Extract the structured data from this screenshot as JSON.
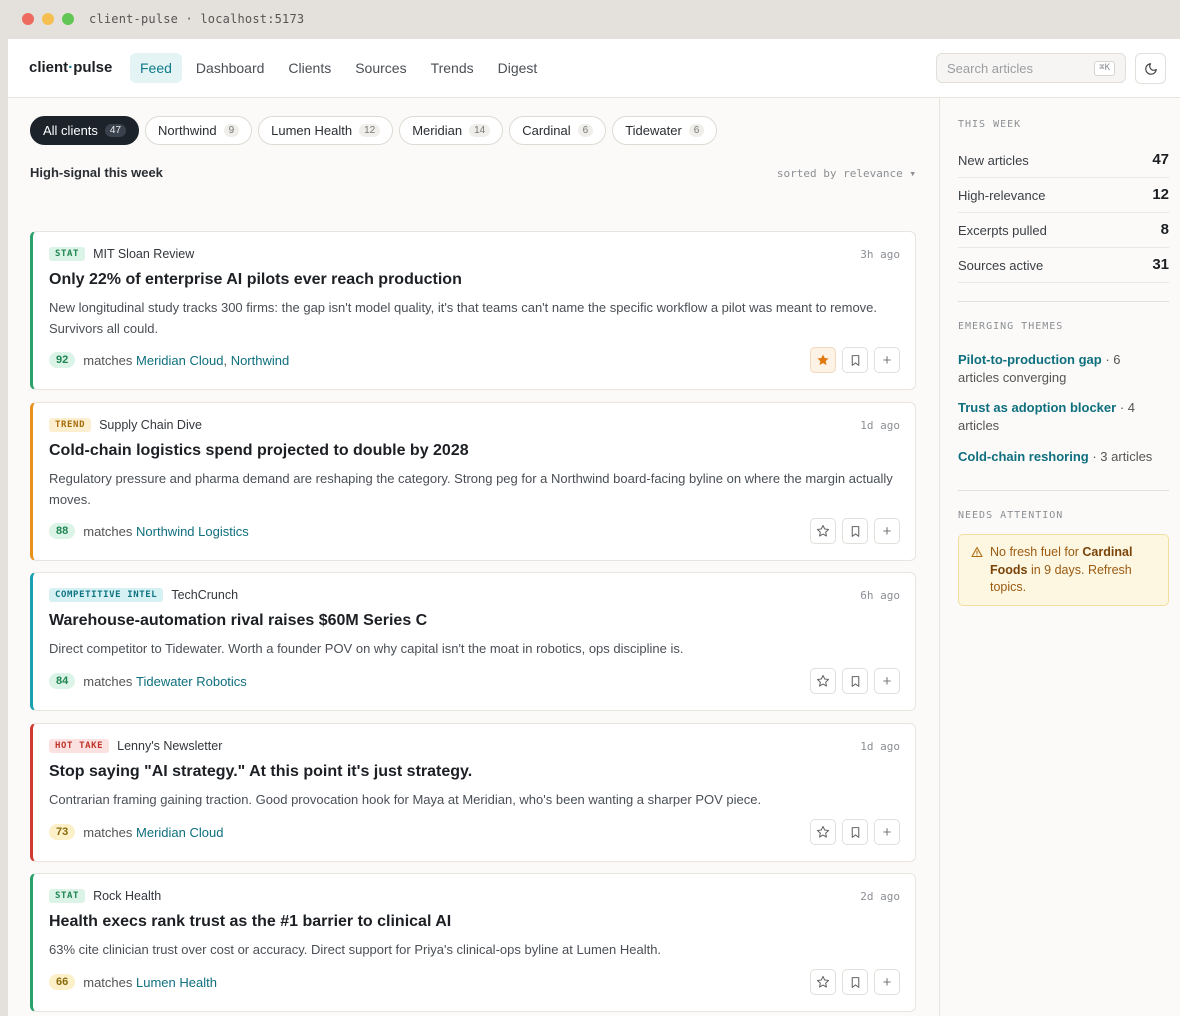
{
  "window": {
    "title": "client-pulse · localhost:5173"
  },
  "app": {
    "logo_left": "client",
    "logo_dot": "·",
    "logo_right": "pulse"
  },
  "nav": {
    "tabs": [
      "Feed",
      "Dashboard",
      "Clients",
      "Sources",
      "Trends",
      "Digest"
    ],
    "active": "Feed"
  },
  "search": {
    "placeholder": "Search articles",
    "shortcut": "⌘K"
  },
  "filters": [
    {
      "label": "All clients",
      "count": "47",
      "active": true
    },
    {
      "label": "Northwind",
      "count": "9"
    },
    {
      "label": "Lumen Health",
      "count": "12"
    },
    {
      "label": "Meridian",
      "count": "14"
    },
    {
      "label": "Cardinal",
      "count": "6"
    },
    {
      "label": "Tidewater",
      "count": "6"
    }
  ],
  "feed": {
    "heading": "High-signal this week",
    "sort_label": "sorted by relevance ▾",
    "matches_label": "matches",
    "cards": [
      {
        "tag": "STAT",
        "source": "MIT Sloan Review",
        "time": "3h ago",
        "title": "Only 22% of enterprise AI pilots ever reach production",
        "desc": "New longitudinal study tracks 300 firms: the gap isn't model quality, it's that teams can't name the specific workflow a pilot was meant to remove. Survivors all could.",
        "score": "92",
        "clients": [
          "Meridian Cloud",
          "Northwind"
        ],
        "starred": true
      },
      {
        "tag": "TREND",
        "source": "Supply Chain Dive",
        "time": "1d ago",
        "title": "Cold-chain logistics spend projected to double by 2028",
        "desc": "Regulatory pressure and pharma demand are reshaping the category. Strong peg for a Northwind board-facing byline on where the margin actually moves.",
        "score": "88",
        "clients": [
          "Northwind Logistics"
        ],
        "starred": false
      },
      {
        "tag": "COMPETITIVE INTEL",
        "source": "TechCrunch",
        "time": "6h ago",
        "title": "Warehouse-automation rival raises $60M Series C",
        "desc": "Direct competitor to Tidewater. Worth a founder POV on why capital isn't the moat in robotics, ops discipline is.",
        "score": "84",
        "clients": [
          "Tidewater Robotics"
        ],
        "starred": false
      },
      {
        "tag": "HOT TAKE",
        "source": "Lenny's Newsletter",
        "time": "1d ago",
        "title": "Stop saying \"AI strategy.\" At this point it's just strategy.",
        "desc": "Contrarian framing gaining traction. Good provocation hook for Maya at Meridian, who's been wanting a sharper POV piece.",
        "score": "73",
        "clients": [
          "Meridian Cloud"
        ],
        "starred": false
      },
      {
        "tag": "STAT",
        "source": "Rock Health",
        "time": "2d ago",
        "title": "Health execs rank trust as the #1 barrier to clinical AI",
        "desc": "63% cite clinician trust over cost or accuracy. Direct support for Priya's clinical-ops byline at Lumen Health.",
        "score": "66",
        "clients": [
          "Lumen Health"
        ],
        "starred": false
      }
    ]
  },
  "sidebar": {
    "this_week": {
      "heading": "THIS WEEK",
      "stats": [
        {
          "label": "New articles",
          "value": "47"
        },
        {
          "label": "High-relevance",
          "value": "12"
        },
        {
          "label": "Excerpts pulled",
          "value": "8"
        },
        {
          "label": "Sources active",
          "value": "31"
        }
      ]
    },
    "themes": {
      "heading": "EMERGING THEMES",
      "items": [
        {
          "name": "Pilot-to-production gap",
          "detail": " · 6 articles converging"
        },
        {
          "name": "Trust as adoption blocker",
          "detail": " · 4 articles"
        },
        {
          "name": "Cold-chain reshoring",
          "detail": " · 3 articles"
        }
      ]
    },
    "attention": {
      "heading": "NEEDS ATTENTION",
      "pre": "No fresh fuel for ",
      "client": "Cardinal Foods",
      "post": " in 9 days. Refresh topics."
    }
  },
  "colors": {
    "accent": "#0e7c8a",
    "stat": "#2aa06b",
    "trend": "#e8921a",
    "intel": "#18a0b0",
    "hot": "#d23a31"
  }
}
